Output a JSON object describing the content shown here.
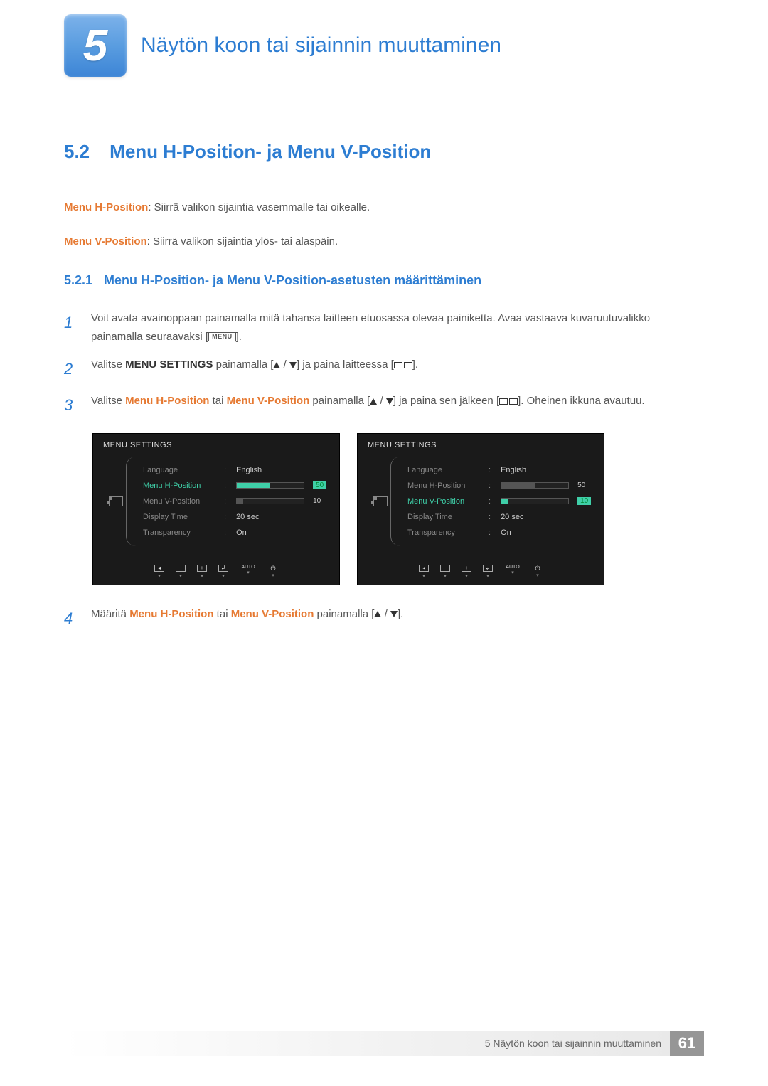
{
  "chapter": {
    "number": "5",
    "title": "Näytön koon tai sijainnin muuttaminen"
  },
  "section": {
    "number": "5.2",
    "title": "Menu H-Position- ja Menu V-Position"
  },
  "intro": {
    "hpos_label": "Menu H-Position",
    "hpos_text": ": Siirrä valikon sijaintia vasemmalle tai oikealle.",
    "vpos_label": "Menu V-Position",
    "vpos_text": ": Siirrä valikon sijaintia ylös- tai alaspäin."
  },
  "subsection": {
    "number": "5.2.1",
    "title": "Menu H-Position- ja Menu V-Position-asetusten määrittäminen"
  },
  "steps": {
    "s1": "Voit avata avainoppaan painamalla mitä tahansa laitteen etuosassa olevaa painiketta. Avaa vastaava kuvaruutuvalikko painamalla seuraavaksi [",
    "s1b": "].",
    "menu_label": "MENU",
    "s2a": "Valitse ",
    "s2_bold": "MENU SETTINGS",
    "s2b": " painamalla [",
    "s2c": "] ja paina laitteessa [",
    "s2d": "].",
    "s3a": "Valitse ",
    "s3_h": "Menu H-Position",
    "s3_mid": " tai ",
    "s3_v": "Menu V-Position",
    "s3b": " painamalla [",
    "s3c": "] ja paina sen jälkeen [",
    "s3d": "]. Oheinen ikkuna avautuu.",
    "s4a": "Määritä ",
    "s4b": " painamalla [",
    "s4c": "]."
  },
  "osd": {
    "title": "MENU SETTINGS",
    "rows": {
      "language": "Language",
      "english": "English",
      "hpos": "Menu H-Position",
      "vpos": "Menu V-Position",
      "display_time": "Display Time",
      "twenty_sec": "20 sec",
      "transparency": "Transparency",
      "on": "On"
    },
    "values": {
      "fifty": "50",
      "ten": "10"
    },
    "footer": {
      "auto": "AUTO"
    }
  },
  "footer": {
    "text": "5 Näytön koon tai sijainnin muuttaminen",
    "page": "61"
  }
}
